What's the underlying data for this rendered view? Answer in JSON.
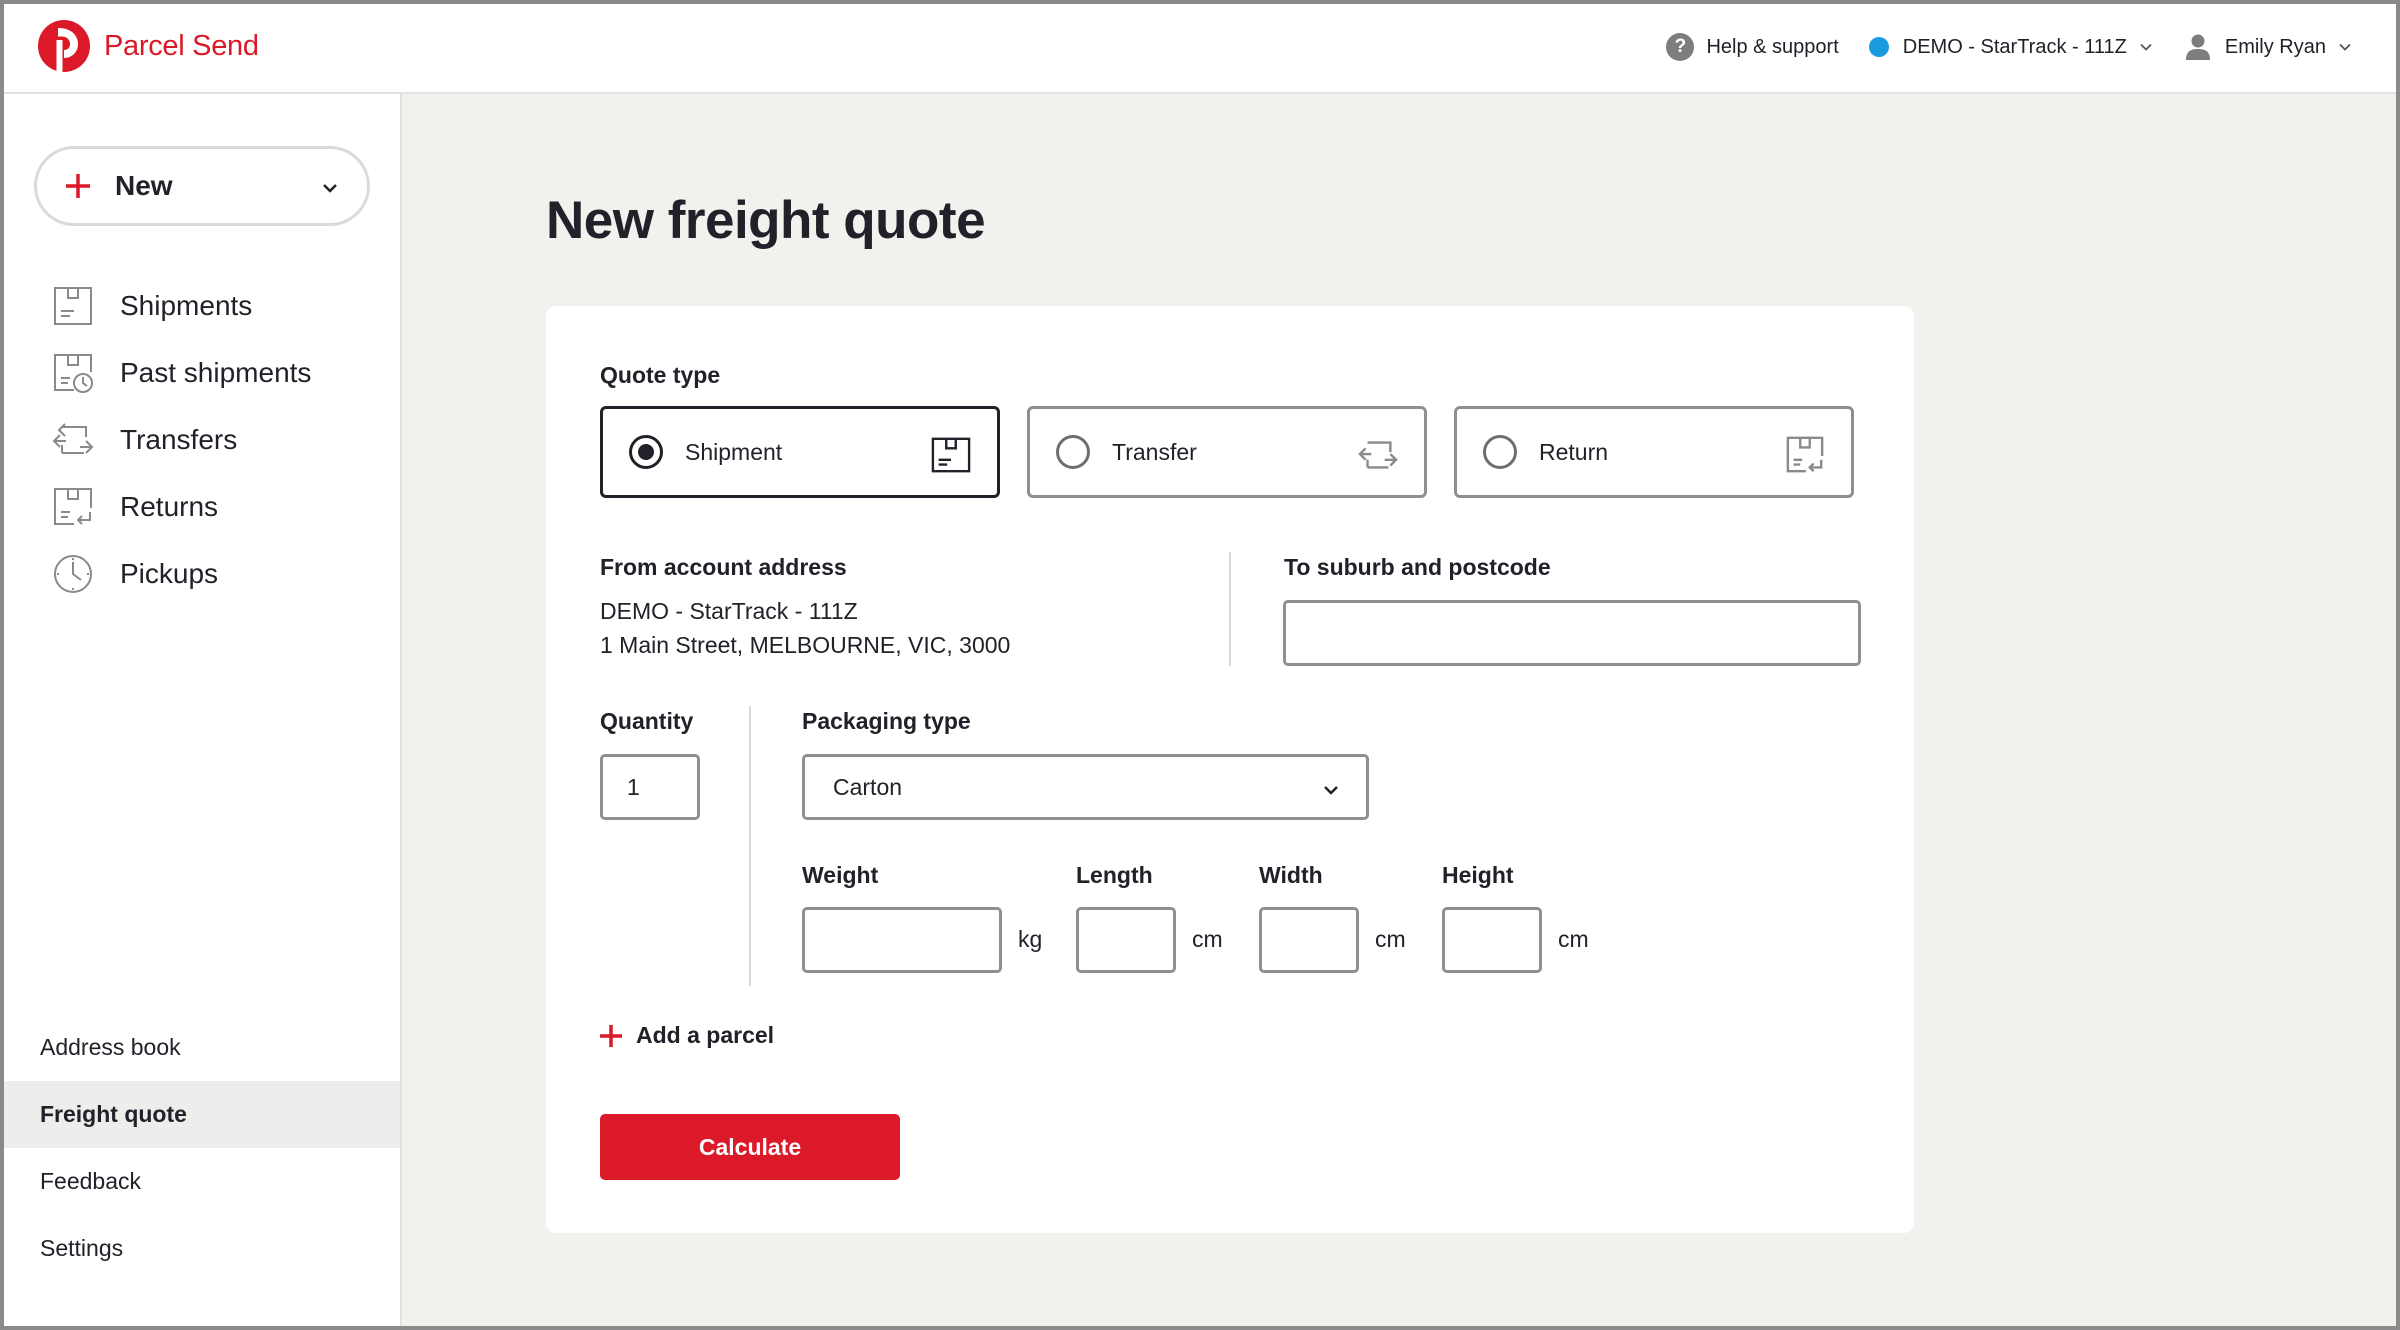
{
  "brand": {
    "name": "Parcel Send",
    "color": "#dc1928"
  },
  "header": {
    "help_label": "Help & support",
    "account_label": "DEMO - StarTrack - 111Z",
    "account_dot_color": "#1a9be0",
    "user_label": "Emily Ryan"
  },
  "sidebar": {
    "new_label": "New",
    "items": [
      {
        "label": "Shipments",
        "icon": "shipments-icon"
      },
      {
        "label": "Past shipments",
        "icon": "past-shipments-icon"
      },
      {
        "label": "Transfers",
        "icon": "transfers-icon"
      },
      {
        "label": "Returns",
        "icon": "returns-icon"
      },
      {
        "label": "Pickups",
        "icon": "pickups-icon"
      }
    ],
    "bottom_items": [
      {
        "label": "Address book",
        "active": false
      },
      {
        "label": "Freight quote",
        "active": true
      },
      {
        "label": "Feedback",
        "active": false
      },
      {
        "label": "Settings",
        "active": false
      }
    ]
  },
  "main": {
    "title": "New freight quote",
    "quote_type": {
      "label": "Quote type",
      "options": [
        {
          "label": "Shipment",
          "selected": true
        },
        {
          "label": "Transfer",
          "selected": false
        },
        {
          "label": "Return",
          "selected": false
        }
      ]
    },
    "from": {
      "label": "From account address",
      "line1": "DEMO - StarTrack - 111Z",
      "line2": "1 Main Street, MELBOURNE, VIC, 3000"
    },
    "to": {
      "label": "To suburb and postcode",
      "value": ""
    },
    "quantity": {
      "label": "Quantity",
      "value": "1"
    },
    "packaging": {
      "label": "Packaging type",
      "value": "Carton"
    },
    "dims": {
      "weight_label": "Weight",
      "weight_unit": "kg",
      "weight_value": "",
      "length_label": "Length",
      "length_unit": "cm",
      "length_value": "",
      "width_label": "Width",
      "width_unit": "cm",
      "width_value": "",
      "height_label": "Height",
      "height_unit": "cm",
      "height_value": ""
    },
    "add_parcel_label": "Add a parcel",
    "calculate_label": "Calculate"
  }
}
